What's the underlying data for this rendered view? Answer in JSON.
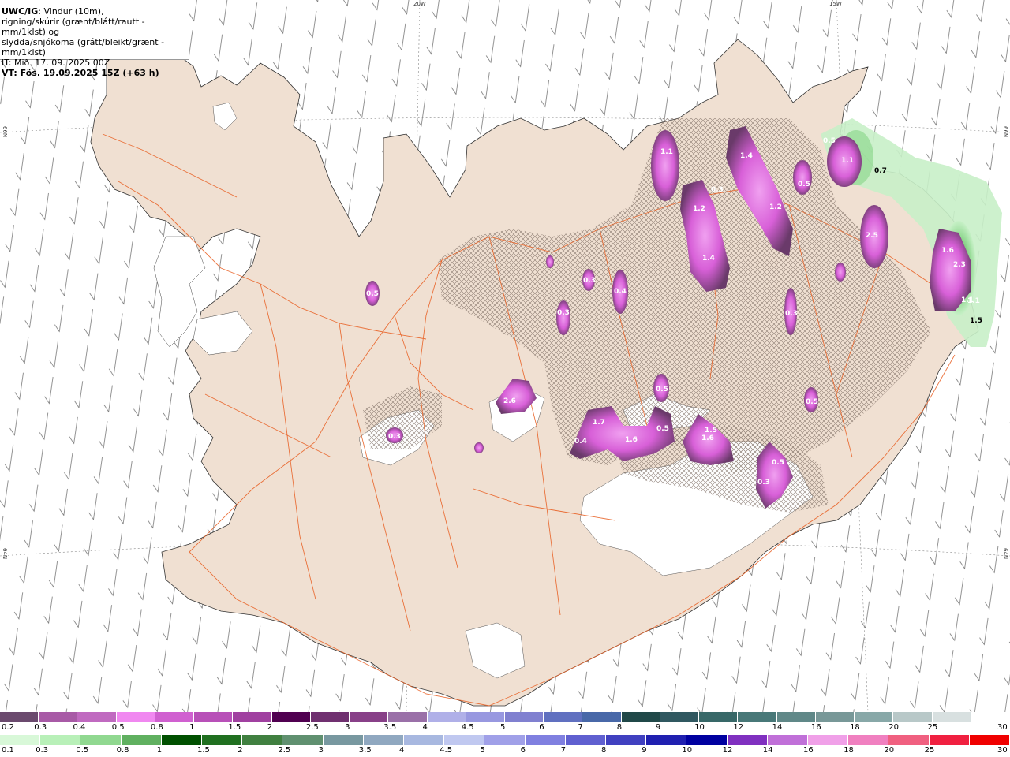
{
  "title": {
    "model": "UWC/IG",
    "line1_rest": ": Vindur (10m),",
    "line2": "rigning/skúrir (grænt/blátt/rautt - mm/1klst) og",
    "line3": "slydda/snjókoma (grátt/bleikt/grænt - mm/1klst)",
    "init_time": "IT: Mið. 17. 09. 2025 00Z",
    "valid_time": "VT: Fös. 19.09.2025 15Z (+63 h)"
  },
  "coords": {
    "top_20w": "20W",
    "top_15w": "15W",
    "left_66n": "66N",
    "right_66n": "66N",
    "left_64n": "64N",
    "right_64n": "64N"
  },
  "precip_labels": [
    {
      "v": "1.1"
    },
    {
      "v": "1.4"
    },
    {
      "v": "0.3"
    },
    {
      "v": "1.2"
    },
    {
      "v": "1.2"
    },
    {
      "v": "0.5"
    },
    {
      "v": "1.4"
    },
    {
      "v": "0.5"
    },
    {
      "v": "1.1"
    },
    {
      "v": "0.7"
    },
    {
      "v": "2.5"
    },
    {
      "v": "1.6"
    },
    {
      "v": "2.3"
    },
    {
      "v": "1.1"
    },
    {
      "v": "1.5"
    },
    {
      "v": "1.1"
    },
    {
      "v": "0.3"
    },
    {
      "v": "0.4"
    },
    {
      "v": "0.3"
    },
    {
      "v": "0.5"
    },
    {
      "v": "0.3"
    },
    {
      "v": "2.6"
    },
    {
      "v": "0.3"
    },
    {
      "v": "0.5"
    },
    {
      "v": "0.5"
    },
    {
      "v": "1.7"
    },
    {
      "v": "0.4"
    },
    {
      "v": "1.6"
    },
    {
      "v": "1.5"
    },
    {
      "v": "1.6"
    },
    {
      "v": "0.5"
    },
    {
      "v": "0.3"
    },
    {
      "v": "0.5"
    }
  ],
  "legend_snow": {
    "ticks": [
      "0.2",
      "0.3",
      "0.4",
      "0.5",
      "0.8",
      "1",
      "1.5",
      "2",
      "2.5",
      "3",
      "3.5",
      "4",
      "4.5",
      "5",
      "6",
      "7",
      "8",
      "9",
      "10",
      "12",
      "14",
      "16",
      "18",
      "20",
      "25",
      "30"
    ],
    "colors": [
      "#6b4a6e",
      "#a85aa6",
      "#c06ac0",
      "#f088f0",
      "#d060d0",
      "#b850b8",
      "#a040a0",
      "#500050",
      "#703070",
      "#884088",
      "#9a70a8",
      "#b0b0e8",
      "#9898e0",
      "#8080d0",
      "#6070c0",
      "#4868a8",
      "#204848",
      "#305860",
      "#386868",
      "#487878",
      "#608888",
      "#789898",
      "#88a8a8",
      "#b8c8c8",
      "#d8e0e0"
    ]
  },
  "legend_rain": {
    "ticks": [
      "0.1",
      "0.3",
      "0.5",
      "0.8",
      "1",
      "1.5",
      "2",
      "2.5",
      "3",
      "3.5",
      "4",
      "4.5",
      "5",
      "6",
      "7",
      "8",
      "9",
      "10",
      "12",
      "14",
      "16",
      "18",
      "20",
      "25",
      "30"
    ],
    "colors": [
      "#d8f8d8",
      "#b8f0b8",
      "#90d890",
      "#60b060",
      "#005000",
      "#207020",
      "#408040",
      "#609070",
      "#7898a0",
      "#90a8c0",
      "#a8b8e0",
      "#c0c8f0",
      "#a0a0e8",
      "#8080e0",
      "#6060d0",
      "#4040c0",
      "#2020b0",
      "#0000a0",
      "#8030c0",
      "#c070d8",
      "#f0a0e8",
      "#f080c0",
      "#f06080",
      "#f02040",
      "#f00000"
    ]
  },
  "colors": {
    "land": "#f0e0d2",
    "glacier": "#ffffff",
    "roads": "#e85c1e",
    "hatch": "#7a6a60",
    "precip_core": "#e070e8",
    "precip_edge": "#6a3a6a",
    "rain_green": "#c8f0c8"
  }
}
